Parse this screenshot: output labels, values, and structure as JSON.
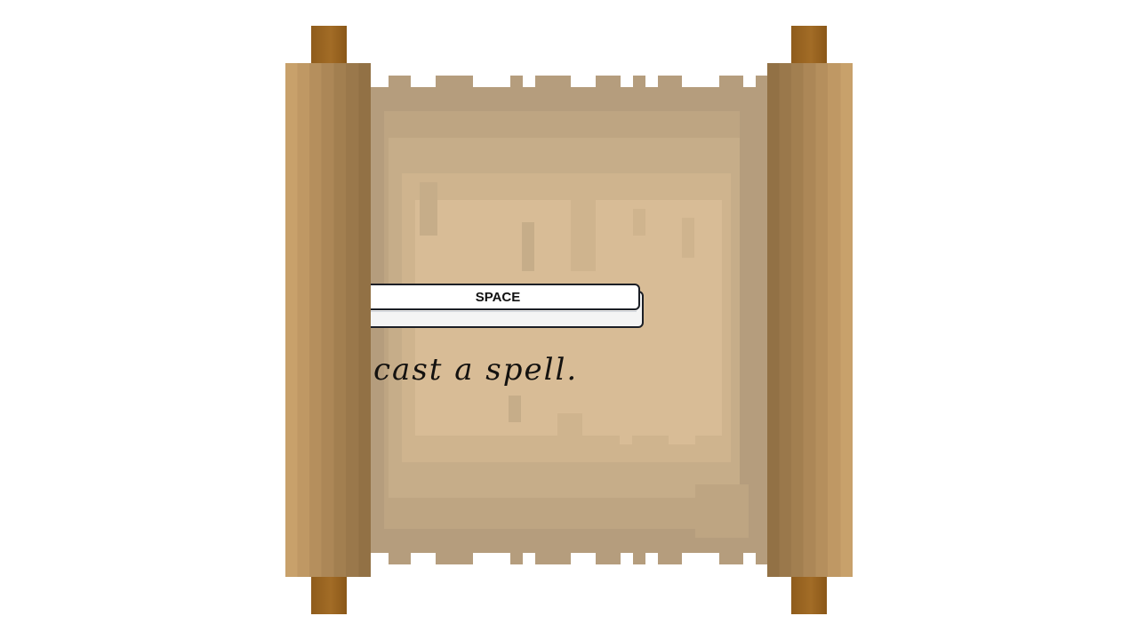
{
  "prompt": {
    "key_label": "SPACE",
    "caption": "cast a spell."
  },
  "colors": {
    "parchment": "#d8bc96",
    "parchment_edge": "#b59d7d",
    "wood_light": "#c8a16b",
    "wood_dark": "#927145",
    "knob": "#a26c26",
    "key_border": "#1c1f26"
  }
}
